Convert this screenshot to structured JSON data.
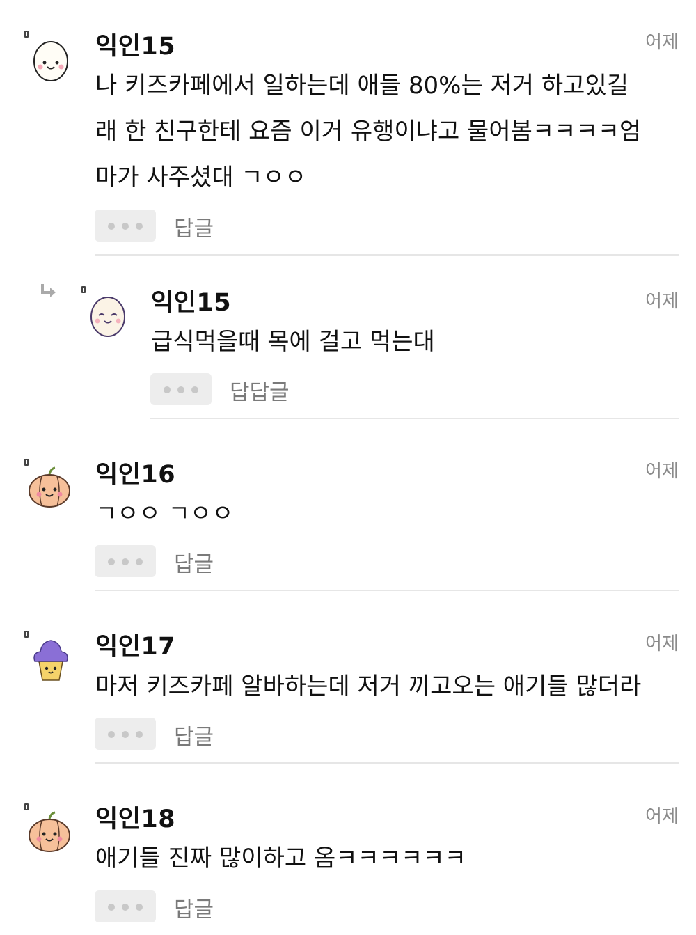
{
  "comments": [
    {
      "author": "익인15",
      "time": "어제",
      "lines": [
        "나 키즈카페에서 일하는데 애들 80%는 저거 하고있길",
        "래 한 친구한테 요즘 이거 유행이냐고 물어봄ㅋㅋㅋㅋ엄",
        "마가 사주셨대 ㄱㅇㅇ"
      ],
      "reply_label": "답글",
      "avatar": "egg-avatar-icon"
    },
    {
      "author": "익인15",
      "time": "어제",
      "lines": [
        "급식먹을때 목에 걸고 먹는대"
      ],
      "reply_label": "답답글",
      "avatar": "egg-avatar-icon",
      "is_reply": true
    },
    {
      "author": "익인16",
      "time": "어제",
      "lines": [
        "ㄱㅇㅇ ㄱㅇㅇ"
      ],
      "reply_label": "답글",
      "avatar": "pumpkin-avatar-icon"
    },
    {
      "author": "익인17",
      "time": "어제",
      "lines": [
        "마저 키즈카페 알바하는데 저거 끼고오는 애기들 많더라"
      ],
      "reply_label": "답글",
      "avatar": "cupcake-avatar-icon"
    },
    {
      "author": "익인18",
      "time": "어제",
      "lines": [
        "애기들 진짜 많이하고 옴ㅋㅋㅋㅋㅋㅋ"
      ],
      "reply_label": "답글",
      "avatar": "pumpkin-avatar-icon"
    }
  ],
  "colors": {
    "text": "#111111",
    "meta": "#8a8a8a",
    "button_bg": "#ededed",
    "divider": "#e6e6e6"
  }
}
